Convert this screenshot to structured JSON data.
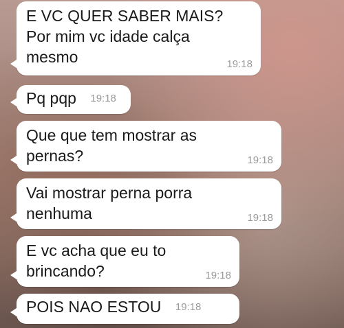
{
  "messages": [
    {
      "text": "E VC QUER SABER MAIS?\nPor mim vc idade calça\nmesmo",
      "time": "19:18"
    },
    {
      "text": "Pq pqp",
      "time": "19:18"
    },
    {
      "text": "Que que tem mostrar as\npernas?",
      "time": "19:18"
    },
    {
      "text": "Vai mostrar perna porra\nnenhuma",
      "time": "19:18"
    },
    {
      "text": "E vc acha que eu to\nbrincando?",
      "time": "19:18"
    },
    {
      "text": "POIS NAO ESTOU",
      "time": "19:18"
    }
  ]
}
